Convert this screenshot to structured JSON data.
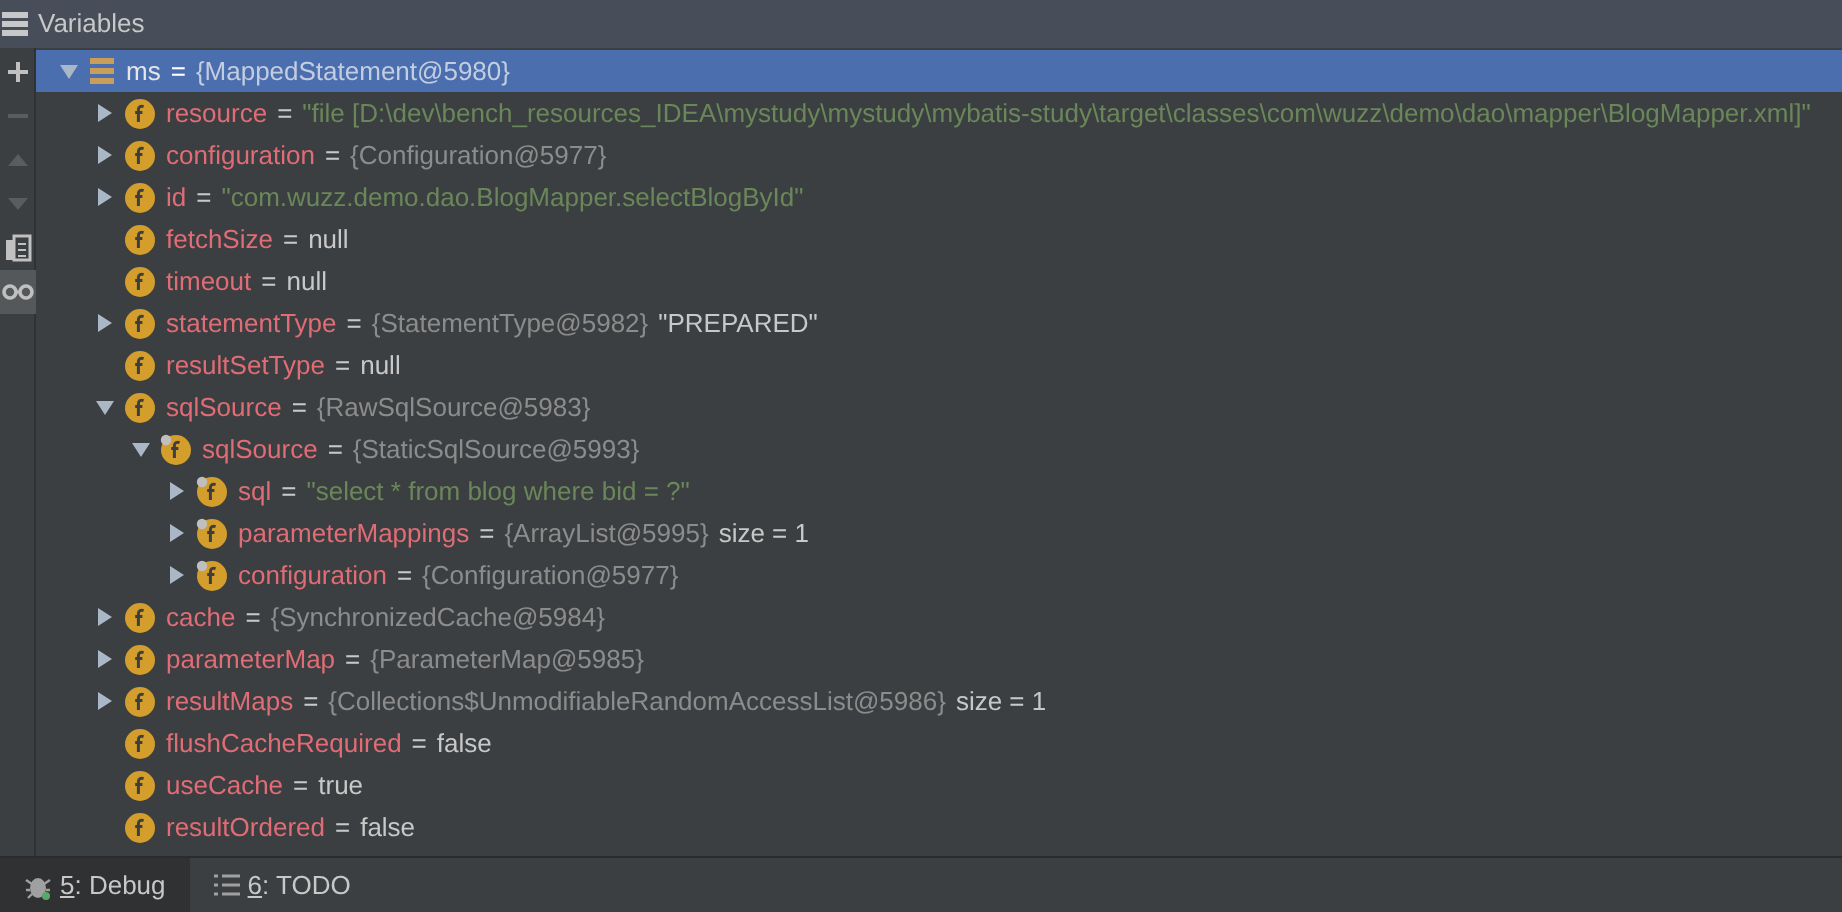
{
  "panel": {
    "title": "Variables"
  },
  "toolbar": [
    {
      "kind": "plus",
      "disabled": false
    },
    {
      "kind": "minus",
      "disabled": true
    },
    {
      "kind": "up",
      "disabled": true
    },
    {
      "kind": "down",
      "disabled": true
    },
    {
      "kind": "copy",
      "disabled": false
    },
    {
      "kind": "glasses",
      "disabled": false,
      "selected": true
    }
  ],
  "tree": [
    {
      "name": "ms",
      "kind": "object",
      "expanded": true,
      "selected": true,
      "parts": [
        {
          "kind": "plain",
          "text": "="
        },
        {
          "kind": "ref",
          "text": "{MappedStatement@5980}"
        }
      ],
      "children": [
        {
          "name": "resource",
          "kind": "field",
          "expanded": false,
          "selected": false,
          "parts": [
            {
              "kind": "plain",
              "text": "="
            },
            {
              "kind": "string",
              "text": "\"file [D:\\dev\\bench_resources_IDEA\\mystudy\\mystudy\\mybatis-study\\target\\classes\\com\\wuzz\\demo\\dao\\mapper\\BlogMapper.xml]\""
            }
          ]
        },
        {
          "name": "configuration",
          "kind": "field",
          "expanded": false,
          "selected": false,
          "parts": [
            {
              "kind": "plain",
              "text": "="
            },
            {
              "kind": "ref",
              "text": "{Configuration@5977}"
            }
          ]
        },
        {
          "name": "id",
          "kind": "field",
          "expanded": false,
          "selected": false,
          "parts": [
            {
              "kind": "plain",
              "text": "="
            },
            {
              "kind": "string",
              "text": "\"com.wuzz.demo.dao.BlogMapper.selectBlogById\""
            }
          ]
        },
        {
          "name": "fetchSize",
          "kind": "field",
          "selected": false,
          "parts": [
            {
              "kind": "plain",
              "text": "="
            },
            {
              "kind": "plain",
              "text": "null"
            }
          ]
        },
        {
          "name": "timeout",
          "kind": "field",
          "selected": false,
          "parts": [
            {
              "kind": "plain",
              "text": "="
            },
            {
              "kind": "plain",
              "text": "null"
            }
          ]
        },
        {
          "name": "statementType",
          "kind": "field",
          "expanded": false,
          "selected": false,
          "parts": [
            {
              "kind": "plain",
              "text": "="
            },
            {
              "kind": "ref",
              "text": "{StatementType@5982}"
            },
            {
              "kind": "plain",
              "text": "\"PREPARED\""
            }
          ]
        },
        {
          "name": "resultSetType",
          "kind": "field",
          "selected": false,
          "parts": [
            {
              "kind": "plain",
              "text": "="
            },
            {
              "kind": "plain",
              "text": "null"
            }
          ]
        },
        {
          "name": "sqlSource",
          "kind": "field",
          "expanded": true,
          "selected": false,
          "parts": [
            {
              "kind": "plain",
              "text": "="
            },
            {
              "kind": "ref",
              "text": "{RawSqlSource@5983}"
            }
          ],
          "children": [
            {
              "name": "sqlSource",
              "kind": "final",
              "expanded": true,
              "selected": false,
              "parts": [
                {
                  "kind": "plain",
                  "text": "="
                },
                {
                  "kind": "ref",
                  "text": "{StaticSqlSource@5993}"
                }
              ],
              "children": [
                {
                  "name": "sql",
                  "kind": "final",
                  "expanded": false,
                  "selected": false,
                  "parts": [
                    {
                      "kind": "plain",
                      "text": "="
                    },
                    {
                      "kind": "string",
                      "text": "\"select * from blog where bid = ?\""
                    }
                  ]
                },
                {
                  "name": "parameterMappings",
                  "kind": "final",
                  "expanded": false,
                  "selected": false,
                  "parts": [
                    {
                      "kind": "plain",
                      "text": "="
                    },
                    {
                      "kind": "ref",
                      "text": "{ArrayList@5995}"
                    },
                    {
                      "kind": "plain",
                      "text": "size = 1"
                    }
                  ]
                },
                {
                  "name": "configuration",
                  "kind": "final",
                  "expanded": false,
                  "selected": false,
                  "parts": [
                    {
                      "kind": "plain",
                      "text": "="
                    },
                    {
                      "kind": "ref",
                      "text": "{Configuration@5977}"
                    }
                  ]
                }
              ]
            }
          ]
        },
        {
          "name": "cache",
          "kind": "field",
          "expanded": false,
          "selected": false,
          "parts": [
            {
              "kind": "plain",
              "text": "="
            },
            {
              "kind": "ref",
              "text": "{SynchronizedCache@5984}"
            }
          ]
        },
        {
          "name": "parameterMap",
          "kind": "field",
          "expanded": false,
          "selected": false,
          "parts": [
            {
              "kind": "plain",
              "text": "="
            },
            {
              "kind": "ref",
              "text": "{ParameterMap@5985}"
            }
          ]
        },
        {
          "name": "resultMaps",
          "kind": "field",
          "expanded": false,
          "selected": false,
          "parts": [
            {
              "kind": "plain",
              "text": "="
            },
            {
              "kind": "ref",
              "text": "{Collections$UnmodifiableRandomAccessList@5986}"
            },
            {
              "kind": "plain",
              "text": "size = 1"
            }
          ]
        },
        {
          "name": "flushCacheRequired",
          "kind": "field",
          "selected": false,
          "parts": [
            {
              "kind": "plain",
              "text": "="
            },
            {
              "kind": "plain",
              "text": "false"
            }
          ]
        },
        {
          "name": "useCache",
          "kind": "field",
          "selected": false,
          "parts": [
            {
              "kind": "plain",
              "text": "="
            },
            {
              "kind": "plain",
              "text": "true"
            }
          ]
        },
        {
          "name": "resultOrdered",
          "kind": "field",
          "selected": false,
          "parts": [
            {
              "kind": "plain",
              "text": "="
            },
            {
              "kind": "plain",
              "text": "false"
            }
          ]
        }
      ]
    }
  ],
  "bottom_tabs": [
    {
      "mnemonic": "5",
      "label": ": Debug",
      "kind": "debug",
      "selected": true
    },
    {
      "mnemonic": "6",
      "label": ": TODO",
      "kind": "todo",
      "selected": false
    }
  ]
}
